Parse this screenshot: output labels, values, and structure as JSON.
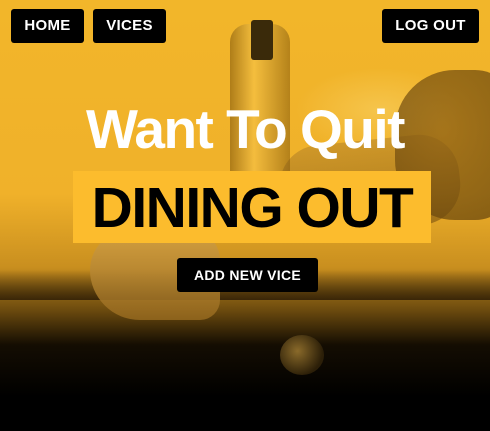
{
  "nav": {
    "home_label": "HOME",
    "vices_label": "VICES",
    "logout_label": "LOG OUT"
  },
  "hero": {
    "headline": "Want To Quit",
    "vice_name": "DINING OUT",
    "add_button_label": "ADD NEW VICE"
  },
  "colors": {
    "accent": "#fcbc2d",
    "button_bg": "#000000",
    "button_text": "#ffffff"
  }
}
